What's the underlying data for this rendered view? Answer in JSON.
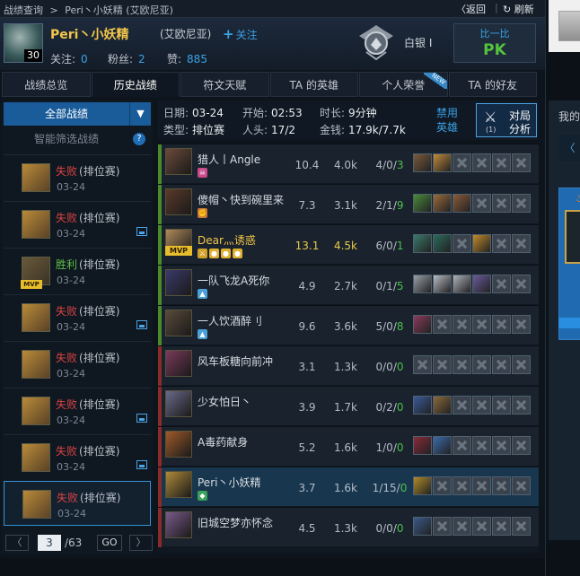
{
  "breadcrumb": {
    "parts": [
      "战绩查询",
      ">",
      "Peri丶小妖精 (艾欧尼亚)"
    ]
  },
  "topbar": {
    "back": "〈返回",
    "separator": "|",
    "refresh": "刷新"
  },
  "profile": {
    "name": "Peri丶小妖精",
    "server": "(艾欧尼亚)",
    "follow": "关注",
    "level": "30",
    "stats": [
      {
        "label": "关注:",
        "value": "0"
      },
      {
        "label": "粉丝:",
        "value": "2"
      },
      {
        "label": "赞:",
        "value": "885"
      }
    ],
    "rank": "白银 I",
    "pk": {
      "line1": "比一比",
      "line2": "PK"
    }
  },
  "tabs": [
    {
      "label": "战绩总览",
      "active": false
    },
    {
      "label": "历史战绩",
      "active": true
    },
    {
      "label": "符文天赋",
      "active": false
    },
    {
      "label": "TA 的英雄",
      "active": false
    },
    {
      "label": "个人荣誉",
      "active": false,
      "badge": "NEW"
    },
    {
      "label": "TA 的好友",
      "active": false
    }
  ],
  "filter": {
    "all": "全部战绩",
    "smart": "智能筛选战绩",
    "help": "?"
  },
  "games": [
    {
      "result": "失败",
      "result_type": "lose",
      "mode": "(排位赛)",
      "date": "03-24",
      "mvp": false,
      "has_image": false,
      "selected": false
    },
    {
      "result": "失败",
      "result_type": "lose",
      "mode": "(排位赛)",
      "date": "03-24",
      "mvp": false,
      "has_image": true,
      "selected": false
    },
    {
      "result": "胜利",
      "result_type": "win",
      "mode": "(排位赛)",
      "date": "03-24",
      "mvp": true,
      "has_image": false,
      "selected": false
    },
    {
      "result": "失败",
      "result_type": "lose",
      "mode": "(排位赛)",
      "date": "03-24",
      "mvp": false,
      "has_image": true,
      "selected": false
    },
    {
      "result": "失败",
      "result_type": "lose",
      "mode": "(排位赛)",
      "date": "03-24",
      "mvp": false,
      "has_image": false,
      "selected": false
    },
    {
      "result": "失败",
      "result_type": "lose",
      "mode": "(排位赛)",
      "date": "03-24",
      "mvp": false,
      "has_image": true,
      "selected": false
    },
    {
      "result": "失败",
      "result_type": "lose",
      "mode": "(排位赛)",
      "date": "03-24",
      "mvp": false,
      "has_image": true,
      "selected": false
    },
    {
      "result": "失败",
      "result_type": "lose",
      "mode": "(排位赛)",
      "date": "03-24",
      "mvp": false,
      "has_image": false,
      "selected": true
    }
  ],
  "pager": {
    "prev": "〈",
    "current": "3",
    "total": "/63",
    "go": "GO",
    "next": "〉"
  },
  "match": {
    "date_label": "日期:",
    "date": "03-24",
    "start_label": "开始:",
    "start": "02:53",
    "duration_label": "时长:",
    "duration": "9分钟",
    "type_label": "类型:",
    "type": "排位赛",
    "heads_label": "人头:",
    "heads": "17/2",
    "gold_label": "金钱:",
    "gold": "17.9k/7.7k",
    "ban": [
      "禁用",
      "英雄"
    ],
    "vs": {
      "line1": "对局",
      "line2": "分析",
      "sub": "(1)"
    }
  },
  "players": [
    {
      "name": "猎人丨Angle",
      "score": "10.4",
      "gold": "4.0k",
      "k": "4",
      "d": "0",
      "a": "3",
      "team": "green",
      "mvp": false,
      "me": false,
      "highlight": false,
      "badges": [
        "skull"
      ],
      "items": [
        "#7a5a3a",
        "#c08a3a",
        "empty",
        "empty",
        "empty",
        "empty"
      ]
    },
    {
      "name": "傻帽丶快到碗里来",
      "score": "7.3",
      "gold": "3.1k",
      "k": "2",
      "d": "1",
      "a": "9",
      "team": "green",
      "mvp": false,
      "me": false,
      "highlight": false,
      "badges": [
        "fist"
      ],
      "items": [
        "#4a8a3a",
        "#9a6a3a",
        "#8a5a3a",
        "empty",
        "empty",
        "empty"
      ]
    },
    {
      "name": "Dear灬诱惑",
      "score": "13.1",
      "gold": "4.5k",
      "k": "6",
      "d": "0",
      "a": "1",
      "team": "green",
      "mvp": true,
      "me": false,
      "highlight": true,
      "badges": [
        "sword",
        "gold",
        "gold",
        "gold"
      ],
      "items": [
        "#3a7a6a",
        "#2a6a5a",
        "empty",
        "#c08a2a",
        "empty",
        "empty"
      ]
    },
    {
      "name": "一队飞龙A死你",
      "score": "4.9",
      "gold": "2.7k",
      "k": "0",
      "d": "1",
      "a": "5",
      "team": "green",
      "mvp": false,
      "me": false,
      "highlight": false,
      "badges": [
        "ward"
      ],
      "items": [
        "#9aa0a8",
        "#b8bcc4",
        "#aeb2ba",
        "#6a5a9a",
        "empty",
        "empty"
      ]
    },
    {
      "name": "一人饮酒醉刂",
      "score": "9.6",
      "gold": "3.6k",
      "k": "5",
      "d": "0",
      "a": "8",
      "team": "green",
      "mvp": false,
      "me": false,
      "highlight": false,
      "badges": [
        "ward"
      ],
      "items": [
        "#8a3a5a",
        "empty",
        "empty",
        "empty",
        "empty",
        "empty"
      ]
    },
    {
      "name": "风车板糖向前冲",
      "score": "3.1",
      "gold": "1.3k",
      "k": "0",
      "d": "0",
      "a": "0",
      "team": "red",
      "mvp": false,
      "me": false,
      "highlight": false,
      "badges": [],
      "items": [
        "empty",
        "empty",
        "empty",
        "empty",
        "empty",
        "empty"
      ]
    },
    {
      "name": "少女怕日丶",
      "score": "3.9",
      "gold": "1.7k",
      "k": "0",
      "d": "2",
      "a": "0",
      "team": "red",
      "mvp": false,
      "me": false,
      "highlight": false,
      "badges": [],
      "items": [
        "#3a5a9a",
        "#8a6a3a",
        "empty",
        "empty",
        "empty",
        "empty"
      ]
    },
    {
      "name": "A毒药献身",
      "score": "5.2",
      "gold": "1.6k",
      "k": "1",
      "d": "0",
      "a": "0",
      "team": "red",
      "mvp": false,
      "me": false,
      "highlight": false,
      "badges": [],
      "items": [
        "#8a2a3a",
        "#3a6aaa",
        "empty",
        "empty",
        "empty",
        "empty"
      ]
    },
    {
      "name": "Peri丶小妖精",
      "score": "3.7",
      "gold": "1.6k",
      "k": "1",
      "d": "15",
      "a": "0",
      "team": "red",
      "mvp": false,
      "me": true,
      "highlight": false,
      "badges": [
        "shield"
      ],
      "items": [
        "#b08a2a",
        "empty",
        "empty",
        "empty",
        "empty",
        "empty"
      ]
    },
    {
      "name": "旧城空梦亦怀念",
      "score": "4.5",
      "gold": "1.3k",
      "k": "0",
      "d": "0",
      "a": "0",
      "team": "red",
      "mvp": false,
      "me": false,
      "highlight": false,
      "badges": [],
      "items": [
        "#3a5a8a",
        "empty",
        "empty",
        "empty",
        "empty",
        "empty"
      ]
    }
  ],
  "sidebar_right": {
    "text": "我的",
    "chevron": "〈"
  },
  "colors": {
    "accent": "#3ba0e4",
    "gold_name": "#f2c64a",
    "win": "#5ec04a",
    "lose": "#d94444",
    "team_green": "#4a8a2a",
    "team_red": "#8a2a2a"
  }
}
